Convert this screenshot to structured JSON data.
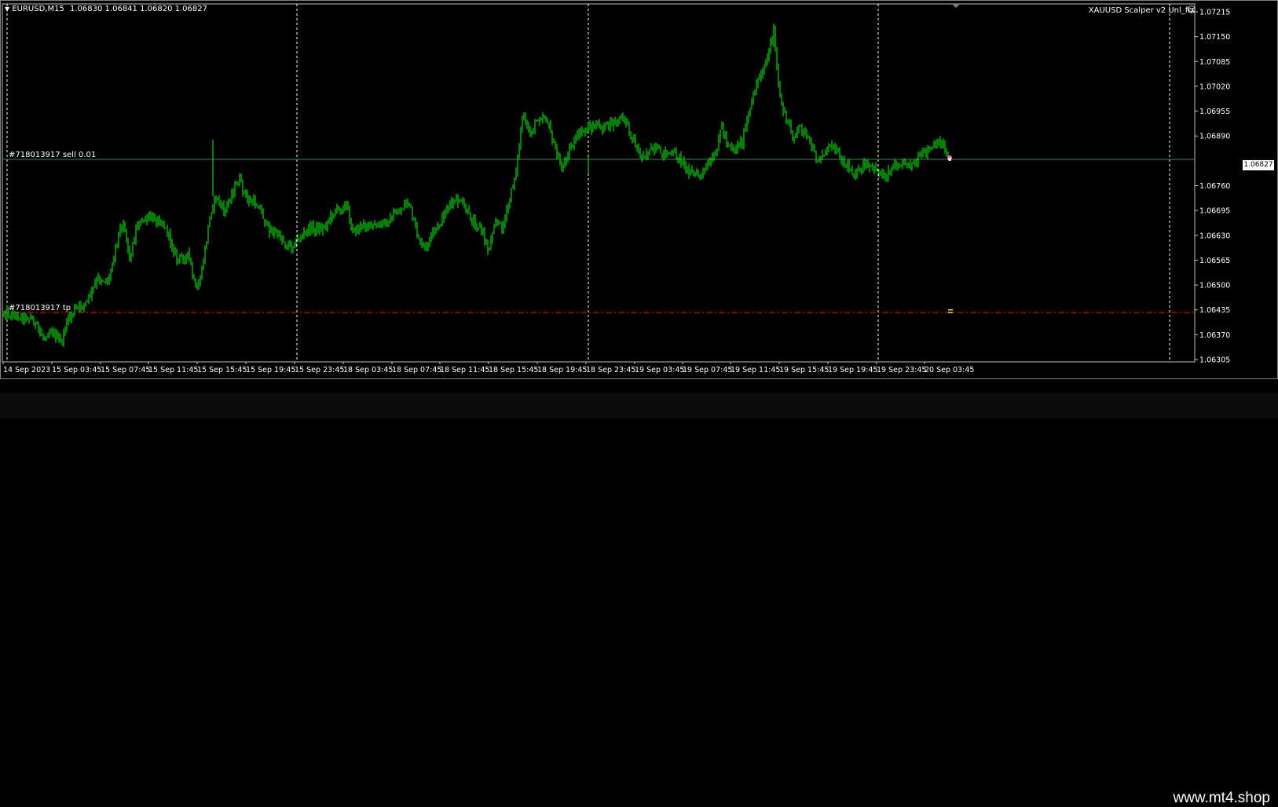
{
  "header": {
    "symbol_tf": "EURUSD,M15",
    "ohlc": "1.06830 1.06841 1.06820 1.06827",
    "expert": "XAUUSD Scalper v2 Unl_fix"
  },
  "orders": {
    "sell_label": "#718013917 sell 0.01",
    "tp_label": "#718013917 tp"
  },
  "price_axis": {
    "ticks": [
      "1.07215",
      "1.07150",
      "1.07085",
      "1.07020",
      "1.06955",
      "1.06890",
      "1.06760",
      "1.06695",
      "1.06630",
      "1.06565",
      "1.06500",
      "1.06435",
      "1.06370",
      "1.06305"
    ],
    "current": "1.06827"
  },
  "time_axis": {
    "labels": [
      "14 Sep 2023",
      "15 Sep 03:45",
      "15 Sep 07:45",
      "15 Sep 11:45",
      "15 Sep 15:45",
      "15 Sep 19:45",
      "15 Sep 23:45",
      "18 Sep 03:45",
      "18 Sep 07:45",
      "18 Sep 11:45",
      "18 Sep 15:45",
      "18 Sep 19:45",
      "18 Sep 23:45",
      "19 Sep 03:45",
      "19 Sep 07:45",
      "19 Sep 11:45",
      "19 Sep 15:45",
      "19 Sep 19:45",
      "19 Sep 23:45",
      "20 Sep 03:45"
    ]
  },
  "colors": {
    "background": "#000000",
    "candle": "#00ff00",
    "sell_line": "#2e8b57",
    "tp_line": "#ff0000",
    "grid": "#ffffff"
  },
  "watermark": "www.mt4.shop"
}
